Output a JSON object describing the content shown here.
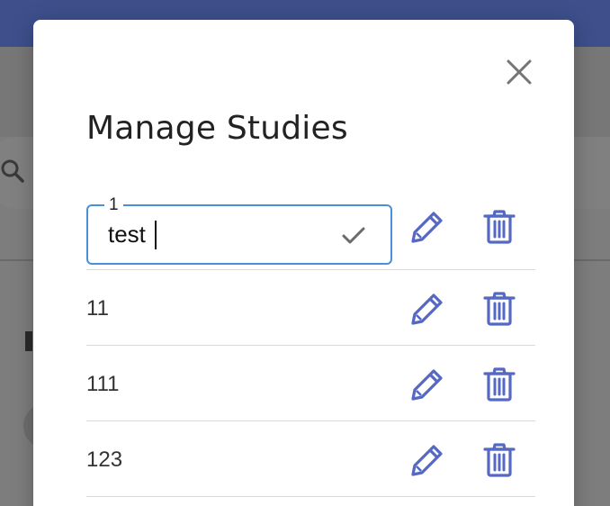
{
  "dialog": {
    "title": "Manage Studies",
    "close_icon": "close-icon"
  },
  "editing_study": {
    "floating_label": "1",
    "value": "test",
    "confirm_icon": "check-icon"
  },
  "studies": [
    {
      "name": "11",
      "edit_icon": "pencil-icon",
      "delete_icon": "trash-icon"
    },
    {
      "name": "111",
      "edit_icon": "pencil-icon",
      "delete_icon": "trash-icon"
    },
    {
      "name": "123",
      "edit_icon": "pencil-icon",
      "delete_icon": "trash-icon"
    }
  ],
  "colors": {
    "accent": "#5468c4",
    "focus_border": "#4a90d9",
    "header_bg": "#3e4f8c"
  }
}
